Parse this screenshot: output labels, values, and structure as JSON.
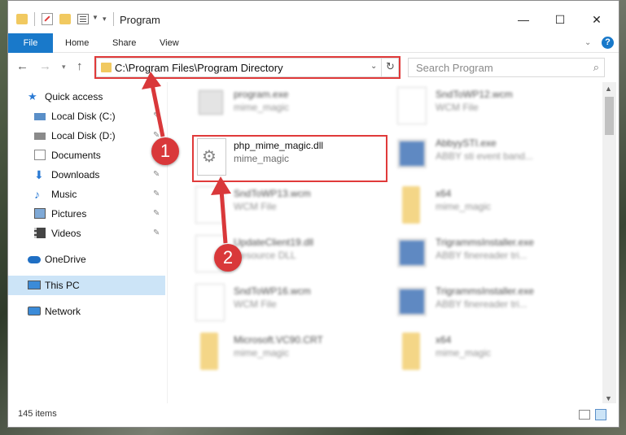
{
  "window": {
    "title": "Program",
    "controls": {
      "minimize": "—",
      "maximize": "☐",
      "close": "✕"
    }
  },
  "ribbon": {
    "tabs": [
      "File",
      "Home",
      "Share",
      "View"
    ],
    "help": "?"
  },
  "nav": {
    "address": "C:\\Program Files\\Program Directory",
    "search_placeholder": "Search Program"
  },
  "sidebar": {
    "items": [
      {
        "label": "Quick access",
        "icon": "star-icon"
      },
      {
        "label": "Local Disk (C:)",
        "icon": "drive-icon"
      },
      {
        "label": "Local Disk (D:)",
        "icon": "drive-icon"
      },
      {
        "label": "Documents",
        "icon": "documents-icon"
      },
      {
        "label": "Downloads",
        "icon": "download-icon"
      },
      {
        "label": "Music",
        "icon": "music-icon"
      },
      {
        "label": "Pictures",
        "icon": "pictures-icon"
      },
      {
        "label": "Videos",
        "icon": "videos-icon"
      },
      {
        "label": "OneDrive",
        "icon": "cloud-icon"
      },
      {
        "label": "This PC",
        "icon": "computer-icon"
      },
      {
        "label": "Network",
        "icon": "network-icon"
      }
    ]
  },
  "files": [
    {
      "name": "program.exe",
      "type": "mime_magic"
    },
    {
      "name": "SndToWP12.wcm",
      "type": "WCM File"
    },
    {
      "name": "php_mime_magic.dll",
      "type": "mime_magic"
    },
    {
      "name": "AbbyySTI.exe",
      "type": "ABBY sti event band..."
    },
    {
      "name": "SndToWP13.wcm",
      "type": "WCM File"
    },
    {
      "name": "x64",
      "type": "mime_magic"
    },
    {
      "name": "UpdateClient19.dll",
      "type": "Resource DLL"
    },
    {
      "name": "TrigrammsInstaller.exe",
      "type": "ABBY finereader tri..."
    },
    {
      "name": "SndToWP16.wcm",
      "type": "WCM File"
    },
    {
      "name": "TrigrammsInstaller.exe",
      "type": "ABBY finereader tri..."
    },
    {
      "name": "Microsoft.VC90.CRT",
      "type": "mime_magic"
    },
    {
      "name": "x64",
      "type": "mime_magic"
    }
  ],
  "status": {
    "count": "145 items"
  },
  "annotations": {
    "step1": "1",
    "step2": "2"
  },
  "colors": {
    "accent": "#1979ca",
    "highlight": "#e03a3a",
    "selected": "#cce4f7"
  }
}
